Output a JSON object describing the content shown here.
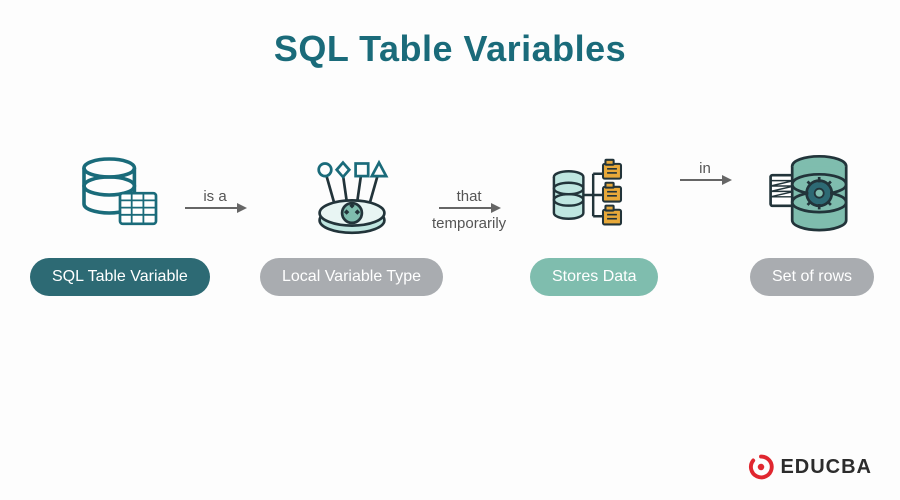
{
  "title": "SQL Table Variables",
  "nodes": [
    {
      "label": "SQL Table Variable",
      "pill": "teal"
    },
    {
      "label": "Local Variable Type",
      "pill": "gray"
    },
    {
      "label": "Stores Data",
      "pill": "green"
    },
    {
      "label": "Set of rows",
      "pill": "gray"
    }
  ],
  "arrows": [
    {
      "label": "is a",
      "sub": ""
    },
    {
      "label": "that",
      "sub": "temporarily"
    },
    {
      "label": "in",
      "sub": ""
    }
  ],
  "brand": "EDUCBA",
  "colors": {
    "title": "#1a6b7a",
    "pill_teal": "#2d6a74",
    "pill_gray": "#a9acb0",
    "pill_green": "#7fbdae",
    "accent_red": "#e0262f"
  }
}
